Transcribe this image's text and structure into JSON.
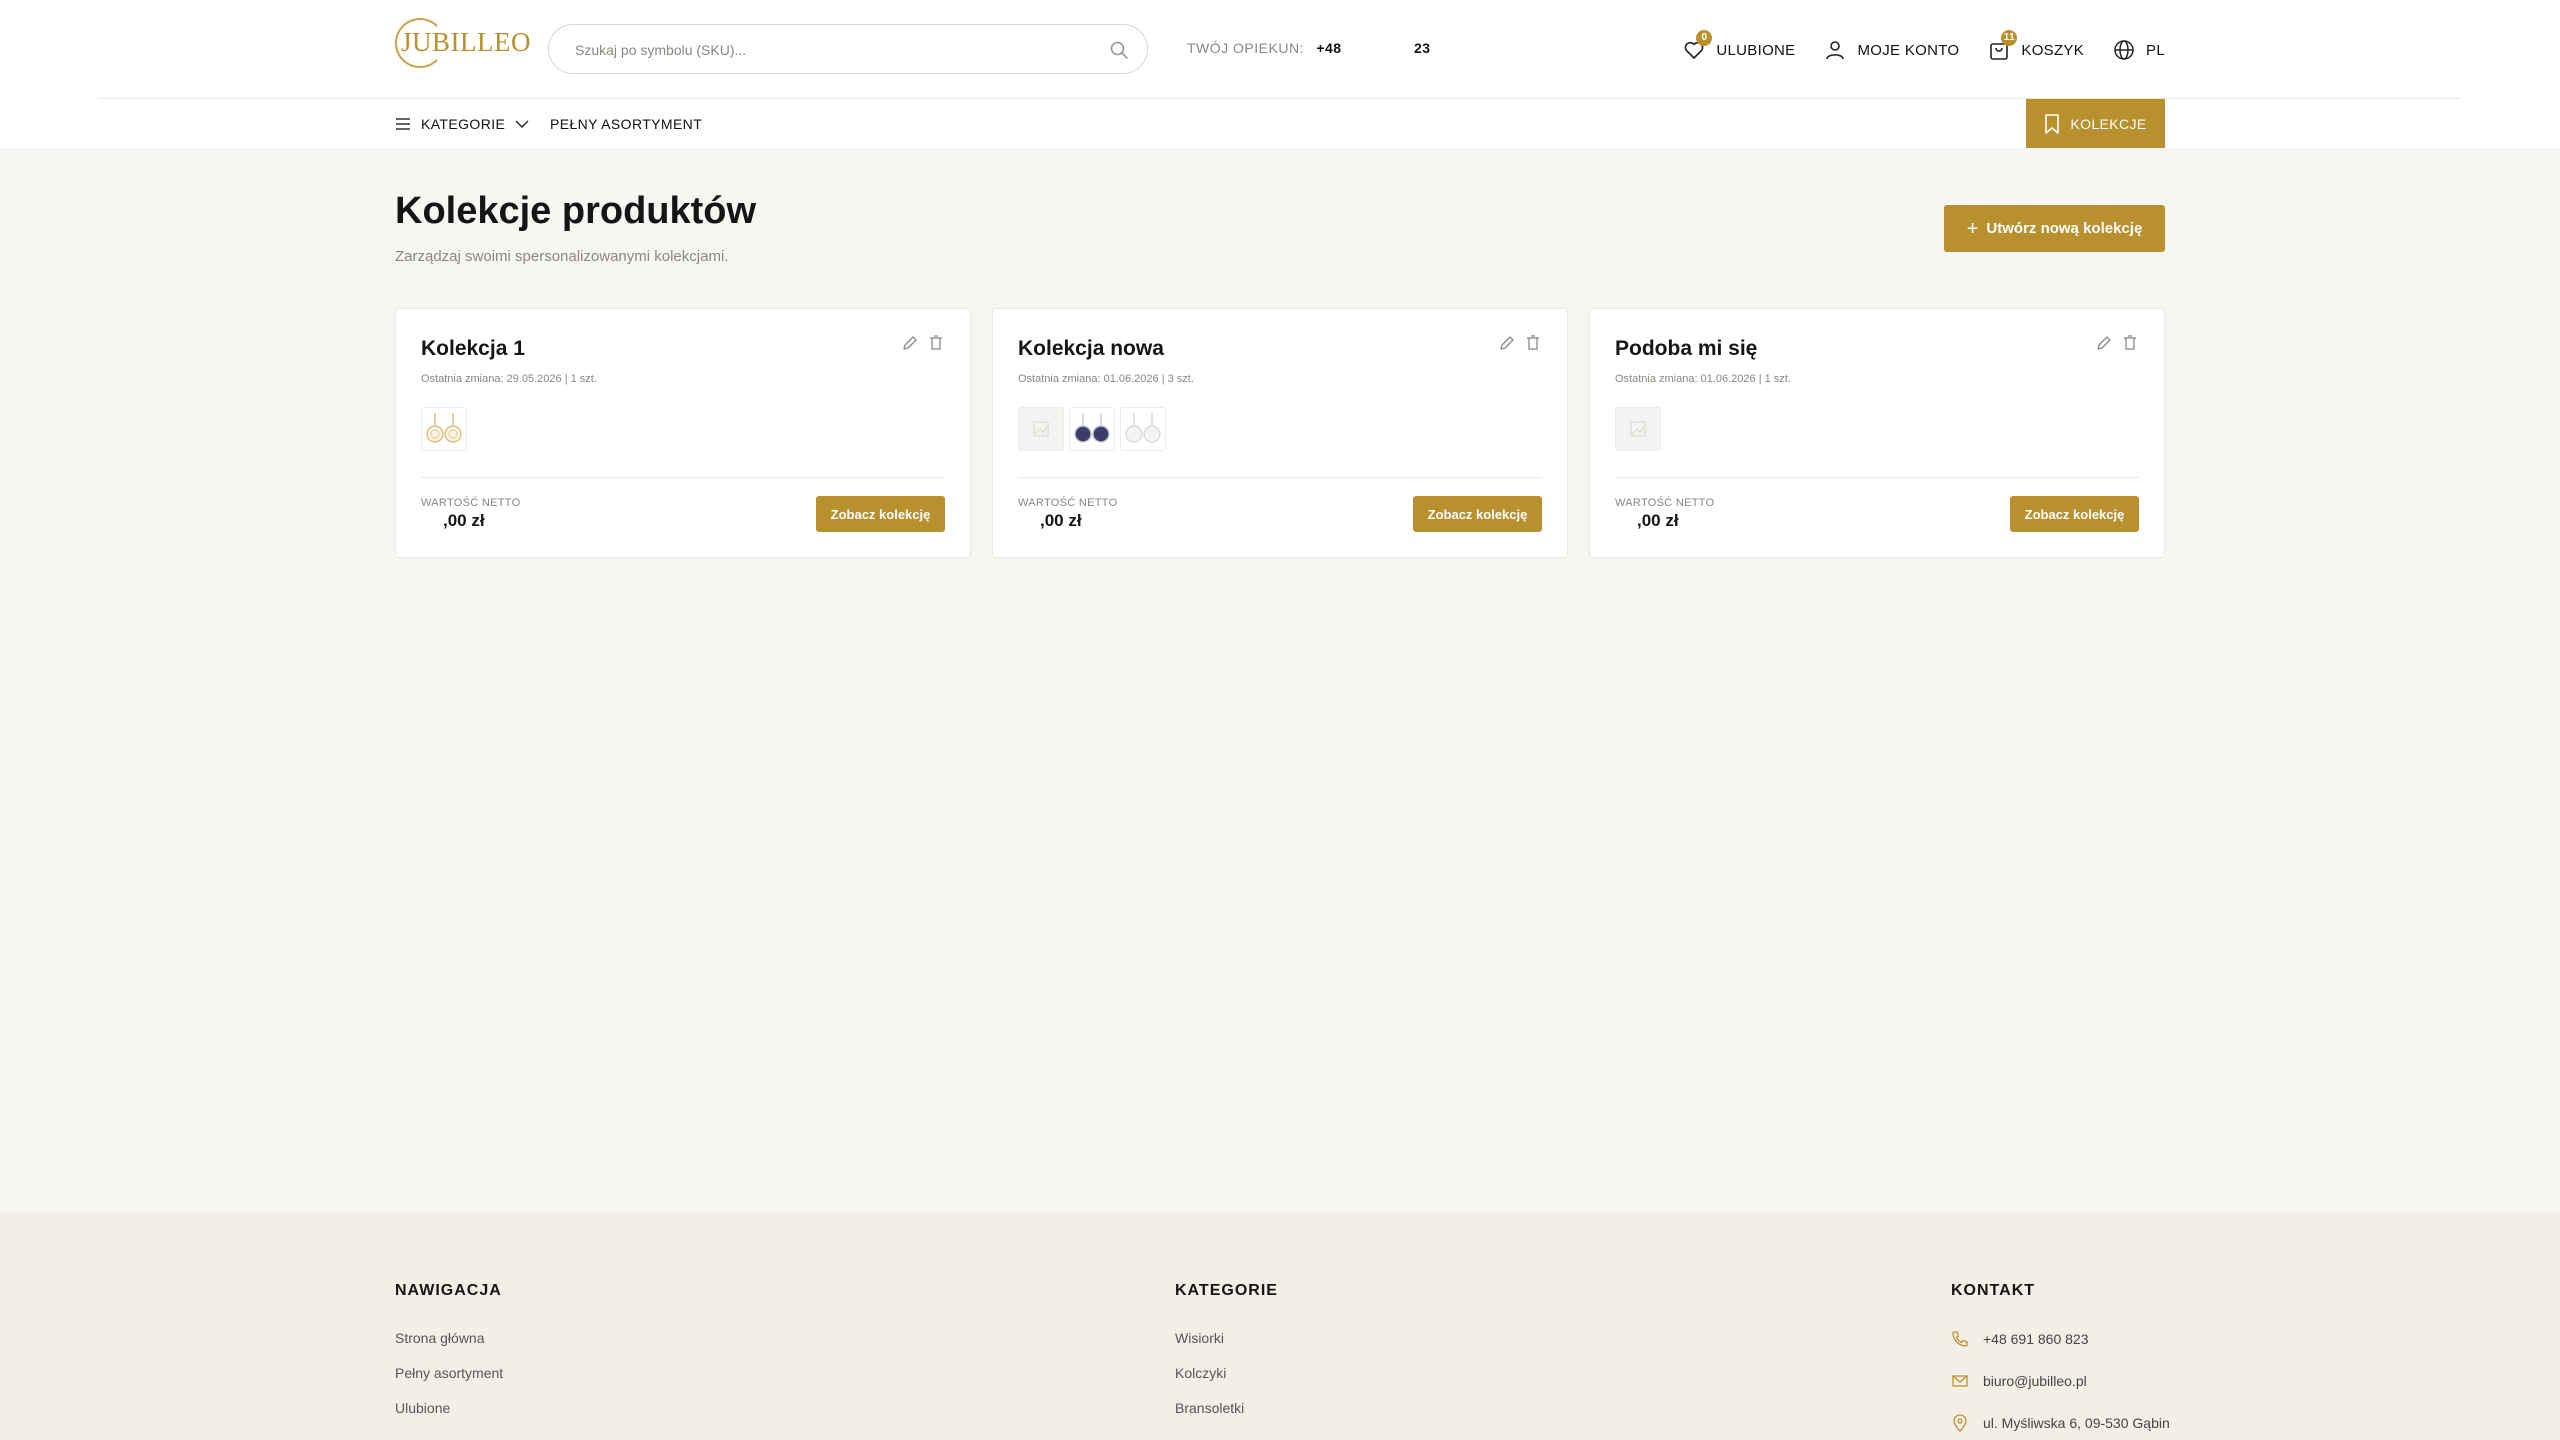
{
  "header": {
    "logo_text": "JUBILLEO",
    "search_placeholder": "Szukaj po symbolu (SKU)...",
    "opiekun_label": "TWÓJ OPIEKUN:",
    "opiekun_phone_a": "+48",
    "opiekun_phone_b": "23",
    "favorites": {
      "label": "ULUBIONE",
      "badge": "0"
    },
    "account": {
      "label": "MOJE KONTO"
    },
    "cart": {
      "label": "KOSZYK",
      "badge": "11"
    },
    "language": {
      "label": "PL"
    }
  },
  "nav": {
    "categories_label": "KATEGORIE",
    "full_range_label": "PEŁNY ASORTYMENT",
    "collections_label": "KOLEKCJE"
  },
  "page": {
    "title": "Kolekcje produktów",
    "subtitle": "Zarządzaj swoimi spersonalizowanymi kolekcjami.",
    "create_button": "Utwórz nową kolekcję"
  },
  "collections": [
    {
      "name": "Kolekcja 1",
      "meta": "Ostatnia zmiana: 29.05.2026 | 1 szt.",
      "value_label": "WARTOŚĆ NETTO",
      "value": ",00 zł",
      "button": "Zobacz kolekcję",
      "thumbs": [
        "gold-earrings"
      ]
    },
    {
      "name": "Kolekcja nowa",
      "meta": "Ostatnia zmiana: 01.06.2026 | 3 szt.",
      "value_label": "WARTOŚĆ NETTO",
      "value": ",00 zł",
      "button": "Zobacz kolekcję",
      "thumbs": [
        "placeholder",
        "navy-earrings",
        "silver-earrings"
      ]
    },
    {
      "name": "Podoba mi się",
      "meta": "Ostatnia zmiana: 01.06.2026 | 1 szt.",
      "value_label": "WARTOŚĆ NETTO",
      "value": ",00 zł",
      "button": "Zobacz kolekcję",
      "thumbs": [
        "placeholder"
      ]
    }
  ],
  "footer": {
    "nav_heading": "NAWIGACJA",
    "nav_links": [
      "Strona główna",
      "Pełny asortyment",
      "Ulubione"
    ],
    "cat_heading": "KATEGORIE",
    "cat_links": [
      "Wisiorki",
      "Kolczyki",
      "Bransoletki"
    ],
    "contact_heading": "KONTAKT",
    "phone": "+48 691 860 823",
    "email": "biuro@jubilleo.pl",
    "address": "ul. Myśliwska 6, 09-530 Gąbin"
  },
  "colors": {
    "accent": "#b8902e",
    "background": "#f8f6f2",
    "footer_bg": "#f4efe6"
  }
}
